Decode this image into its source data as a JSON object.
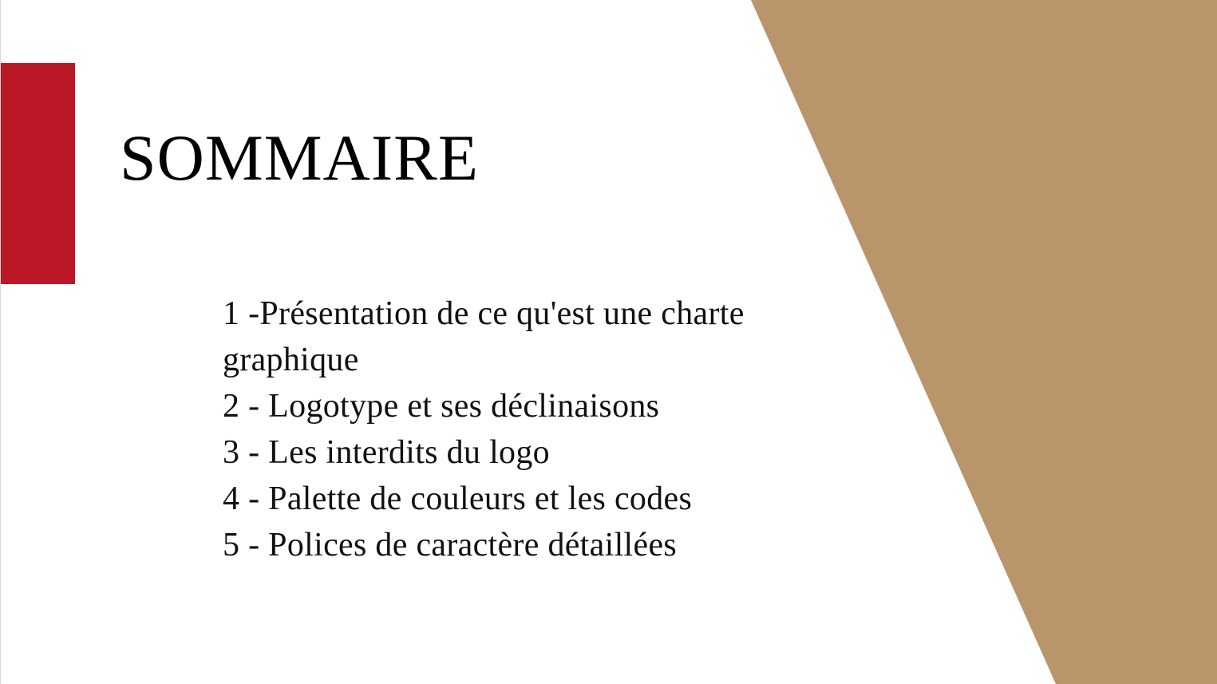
{
  "slide": {
    "title": "SOMMAIRE",
    "items": [
      "1 -Présentation de ce qu'est une charte graphique",
      "2 - Logotype et ses déclinaisons",
      "3 - Les interdits du logo",
      "4 - Palette de couleurs et les codes",
      "5 - Polices de caractère détaillées"
    ]
  },
  "colors": {
    "accent_red": "#BA1826",
    "accent_gold": "#B8956B",
    "background": "#FFFFFF",
    "text": "#000000"
  }
}
